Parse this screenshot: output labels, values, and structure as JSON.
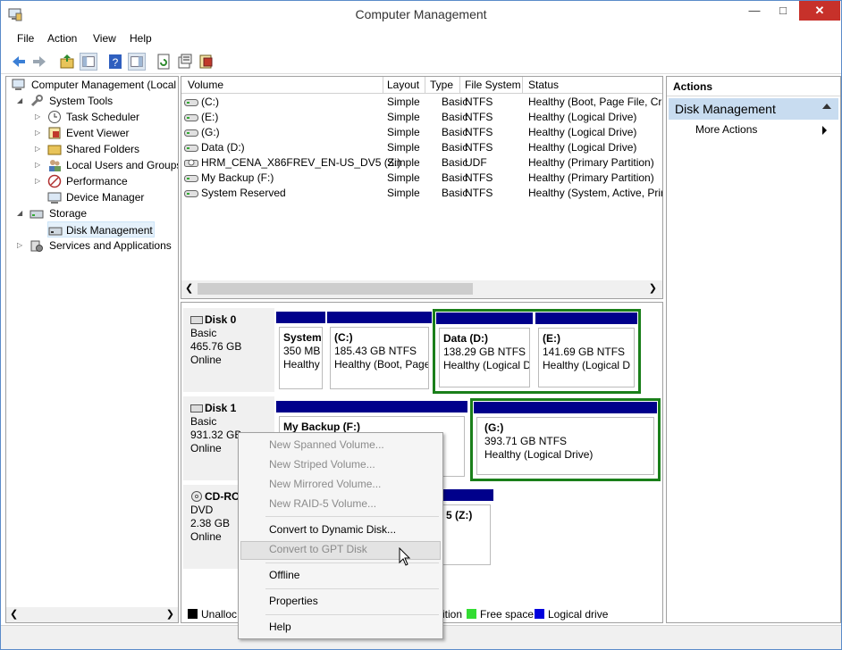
{
  "window": {
    "title": "Computer Management"
  },
  "menu": [
    "File",
    "Action",
    "View",
    "Help"
  ],
  "tree": {
    "root": "Computer Management (Local",
    "system_tools": "System Tools",
    "task_scheduler": "Task Scheduler",
    "event_viewer": "Event Viewer",
    "shared_folders": "Shared Folders",
    "local_users": "Local Users and Groups",
    "performance": "Performance",
    "device_manager": "Device Manager",
    "storage": "Storage",
    "disk_management": "Disk Management",
    "services": "Services and Applications"
  },
  "volumes": {
    "headers": [
      "Volume",
      "Layout",
      "Type",
      "File System",
      "Status"
    ],
    "rows": [
      [
        "(C:)",
        "Simple",
        "Basic",
        "NTFS",
        "Healthy (Boot, Page File, Cra"
      ],
      [
        "(E:)",
        "Simple",
        "Basic",
        "NTFS",
        "Healthy (Logical Drive)"
      ],
      [
        "(G:)",
        "Simple",
        "Basic",
        "NTFS",
        "Healthy (Logical Drive)"
      ],
      [
        "Data (D:)",
        "Simple",
        "Basic",
        "NTFS",
        "Healthy (Logical Drive)"
      ],
      [
        "HRM_CENA_X86FREV_EN-US_DV5 (Z:)",
        "Simple",
        "Basic",
        "UDF",
        "Healthy (Primary Partition)"
      ],
      [
        "My Backup (F:)",
        "Simple",
        "Basic",
        "NTFS",
        "Healthy (Primary Partition)"
      ],
      [
        "System Reserved",
        "Simple",
        "Basic",
        "NTFS",
        "Healthy (System, Active, Prir"
      ]
    ]
  },
  "disks": {
    "disk0": {
      "name": "Disk 0",
      "type": "Basic",
      "size": "465.76 GB",
      "state": "Online"
    },
    "disk1": {
      "name": "Disk 1",
      "type": "Basic",
      "size": "931.32 GB",
      "state": "Online"
    },
    "cdrom": {
      "name": "CD-RO",
      "type": "DVD",
      "size": "2.38 GB",
      "state": "Online"
    }
  },
  "partitions": {
    "system": {
      "title": "System",
      "size": "350 MB",
      "status": "Healthy"
    },
    "c": {
      "title": "(C:)",
      "size": "185.43 GB NTFS",
      "status": "Healthy (Boot, Page"
    },
    "d": {
      "title": "Data  (D:)",
      "size": "138.29 GB NTFS",
      "status": "Healthy (Logical D"
    },
    "e": {
      "title": "(E:)",
      "size": "141.69 GB NTFS",
      "status": "Healthy (Logical D"
    },
    "f": {
      "title": "My Backup  (F:)"
    },
    "g": {
      "title": "(G:)",
      "size": "393.71 GB NTFS",
      "status": "Healthy (Logical Drive)"
    },
    "z": {
      "title": "5  (Z:)"
    }
  },
  "legend": {
    "unalloc": "Unalloc",
    "extended": "ition",
    "free": "Free space",
    "logical": "Logical drive",
    "colors": {
      "unalloc": "#000000",
      "free": "#33dd33",
      "logical": "#0000dd"
    }
  },
  "actions": {
    "header": "Actions",
    "section": "Disk Management",
    "more": "More Actions"
  },
  "context_menu": {
    "spanned": "New Spanned Volume...",
    "striped": "New Striped Volume...",
    "mirrored": "New Mirrored Volume...",
    "raid5": "New RAID-5 Volume...",
    "dynamic": "Convert to Dynamic Disk...",
    "gpt": "Convert to GPT Disk",
    "offline": "Offline",
    "properties": "Properties",
    "help": "Help"
  }
}
